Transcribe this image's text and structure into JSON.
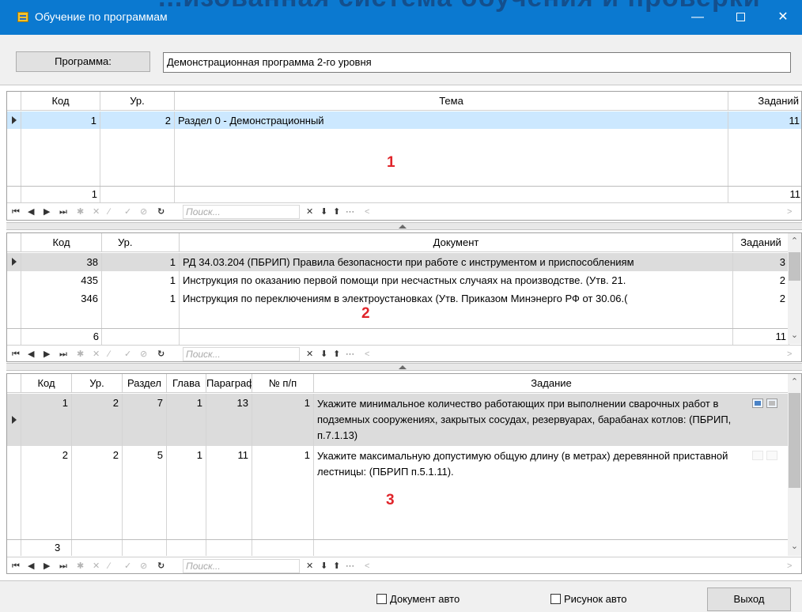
{
  "window": {
    "title": "Обучение по программам",
    "background_text": "...изованная система обучения и проверки",
    "min_glyph": "—",
    "close_glyph": "✕"
  },
  "program": {
    "button_label": "Программа:",
    "value": "Демонстрационная программа 2-го уровня"
  },
  "grid1": {
    "columns": [
      "Код",
      "Ур.",
      "Тема",
      "Заданий"
    ],
    "rows": [
      {
        "code": "1",
        "level": "2",
        "theme": "Раздел 0 - Демонстрационный",
        "tasks": "11"
      }
    ],
    "footer": {
      "code": "1",
      "tasks": "11"
    },
    "label": "1"
  },
  "grid2": {
    "columns": [
      "Код",
      "Ур.",
      "Документ",
      "Заданий"
    ],
    "rows": [
      {
        "code": "38",
        "level": "1",
        "doc": "РД 34.03.204 (ПБРИП) Правила безопасности при работе с инструментом и приспособлениям",
        "tasks": "3"
      },
      {
        "code": "435",
        "level": "1",
        "doc": "Инструкция по оказанию первой помощи при несчастных случаях на производстве. (Утв. 21.",
        "tasks": "2"
      },
      {
        "code": "346",
        "level": "1",
        "doc": "Инструкция по переключениям в электроустановках (Утв. Приказом Минэнерго РФ от 30.06.(",
        "tasks": "2"
      }
    ],
    "footer": {
      "code": "6",
      "tasks": "11"
    },
    "label": "2"
  },
  "grid3": {
    "columns": [
      "Код",
      "Ур.",
      "Раздел",
      "Глава",
      "Параграф",
      "№ п/п",
      "Задание"
    ],
    "rows": [
      {
        "code": "1",
        "level": "2",
        "section": "7",
        "chapter": "1",
        "paragraph": "13",
        "num": "1",
        "task": "Укажите минимальное количество работающих при выполнении сварочных работ в подземных сооружениях, закрытых сосудах, резервуарах, барабанах котлов: (ПБРИП, п.7.1.13)"
      },
      {
        "code": "2",
        "level": "2",
        "section": "5",
        "chapter": "1",
        "paragraph": "11",
        "num": "1",
        "task": "Укажите максимальную допустимую общую длину (в метрах) деревянной приставной лестницы: (ПБРИП п.5.1.11)."
      }
    ],
    "footer": {
      "code": "3"
    },
    "label": "3"
  },
  "navigator": {
    "search_placeholder": "Поиск...",
    "first": "⏮",
    "prior": "◀",
    "next": "▶",
    "last": "⏭",
    "insert": "✱",
    "delete": "✕",
    "edit": "∕",
    "post": "✓",
    "cancel": "⊘",
    "refresh": "↻",
    "clear": "✕",
    "down": "⬇",
    "up": "⬆",
    "more": "···",
    "scroll_left": "<",
    "scroll_right": ">"
  },
  "bottom": {
    "doc_auto": "Документ авто",
    "pic_auto": "Рисунок авто",
    "exit": "Выход"
  },
  "colors": {
    "titlebar": "#0b79d0",
    "selected_row_1": "#cce8ff",
    "selected_row_2": "#dcdcdc",
    "annotation_red": "#e0242a"
  }
}
